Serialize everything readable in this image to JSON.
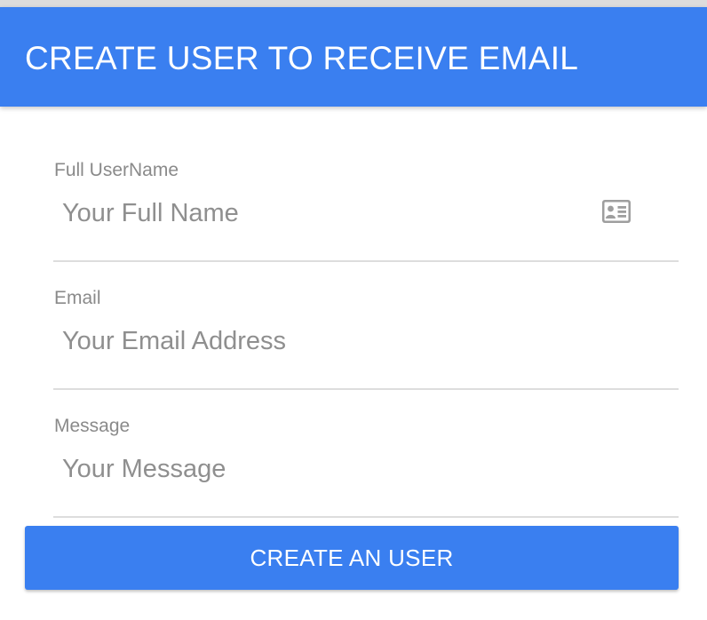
{
  "header": {
    "title": "CREATE USER TO RECEIVE EMAIL"
  },
  "form": {
    "fields": [
      {
        "label": "Full UserName",
        "placeholder": "Your Full Name",
        "value": "",
        "icon": "id-card-icon"
      },
      {
        "label": "Email",
        "placeholder": "Your Email Address",
        "value": ""
      },
      {
        "label": "Message",
        "placeholder": "Your Message",
        "value": ""
      }
    ],
    "submit_label": "CREATE AN USER"
  },
  "colors": {
    "accent": "#3a7ff0",
    "label": "#8a8a8a",
    "placeholder": "#8f8f8f",
    "divider": "#dddddd",
    "icon": "#9e9e9e"
  }
}
